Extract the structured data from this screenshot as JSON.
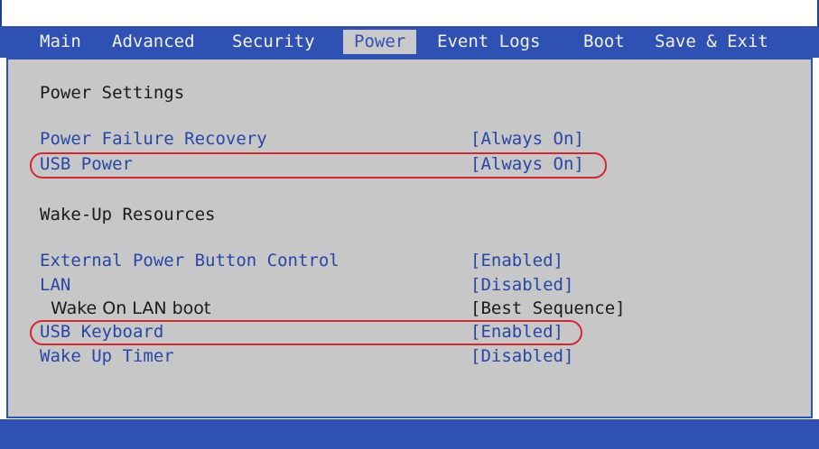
{
  "menu": {
    "tabs": [
      "Main",
      "Advanced",
      "Security",
      "Power",
      "Event Logs",
      "Boot",
      "Save & Exit"
    ],
    "active": "Power"
  },
  "power_settings": {
    "heading": "Power Settings",
    "items": [
      {
        "label": "Power Failure Recovery",
        "value": "[Always On]"
      },
      {
        "label": "USB Power",
        "value": "[Always On]"
      }
    ]
  },
  "wakeup": {
    "heading": "Wake-Up Resources",
    "items": [
      {
        "label": "External Power Button Control",
        "value": "[Enabled]"
      },
      {
        "label": "LAN",
        "value": "[Disabled]"
      },
      {
        "label": "Wake On LAN boot",
        "value": "[Best Sequence]"
      },
      {
        "label": "USB Keyboard",
        "value": "[Enabled]"
      },
      {
        "label": "Wake Up Timer",
        "value": "[Disabled]"
      }
    ]
  },
  "colors": {
    "bar_blue": "#2e51b3",
    "panel_gray": "#c7c7c7",
    "item_blue": "#2747a8",
    "highlight_red": "#d8262e"
  }
}
